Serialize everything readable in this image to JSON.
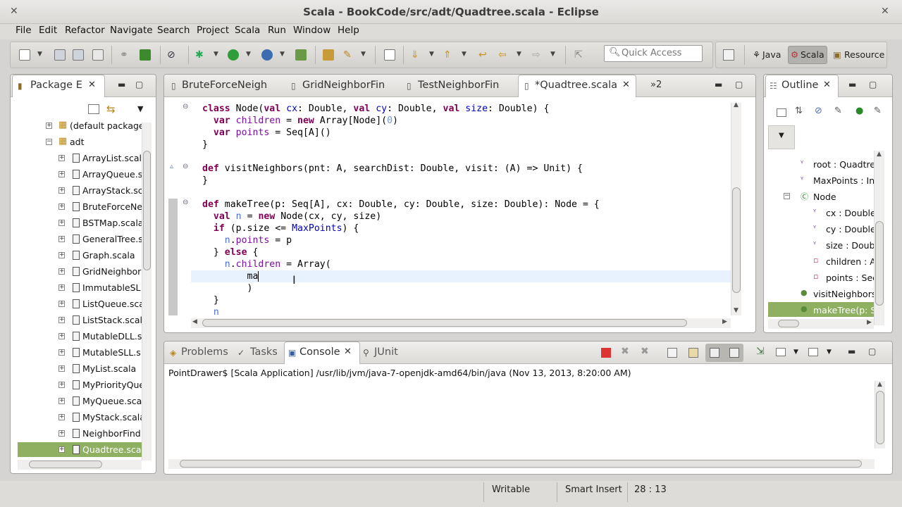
{
  "window": {
    "title": "Scala - BookCode/src/adt/Quadtree.scala - Eclipse"
  },
  "menu": [
    "File",
    "Edit",
    "Refactor",
    "Navigate",
    "Search",
    "Project",
    "Scala",
    "Run",
    "Window",
    "Help"
  ],
  "quick_access": {
    "placeholder": "Quick Access"
  },
  "perspectives": [
    "Java",
    "Scala",
    "Resource"
  ],
  "package_explorer": {
    "title": "Package E",
    "items": [
      {
        "label": "(default package",
        "level": 1
      },
      {
        "label": "adt",
        "level": 1
      },
      {
        "label": "ArrayList.scala",
        "level": 2
      },
      {
        "label": "ArrayQueue.s",
        "level": 2
      },
      {
        "label": "ArrayStack.sc",
        "level": 2
      },
      {
        "label": "BruteForceNe",
        "level": 2
      },
      {
        "label": "BSTMap.scala",
        "level": 2
      },
      {
        "label": "GeneralTree.s",
        "level": 2
      },
      {
        "label": "Graph.scala",
        "level": 2
      },
      {
        "label": "GridNeighbor",
        "level": 2
      },
      {
        "label": "ImmutableSL",
        "level": 2
      },
      {
        "label": "ListQueue.sca",
        "level": 2
      },
      {
        "label": "ListStack.scal",
        "level": 2
      },
      {
        "label": "MutableDLL.s",
        "level": 2
      },
      {
        "label": "MutableSLL.s",
        "level": 2
      },
      {
        "label": "MyList.scala",
        "level": 2
      },
      {
        "label": "MyPriorityQue",
        "level": 2
      },
      {
        "label": "MyQueue.sca",
        "level": 2
      },
      {
        "label": "MyStack.scala",
        "level": 2
      },
      {
        "label": "NeighborFind",
        "level": 2
      },
      {
        "label": "Quadtree.sca",
        "level": 2,
        "selected": true
      }
    ]
  },
  "editor": {
    "tabs": [
      "BruteForceNeigh",
      "GridNeighborFin",
      "TestNeighborFin",
      "*Quadtree.scala"
    ],
    "overflow": "»2",
    "active_tab": 3
  },
  "outline": {
    "title": "Outline",
    "items": [
      "root : Quadtree",
      "MaxPoints : Int",
      "Node",
      "cx : Double",
      "cy : Double",
      "size : Double",
      "children : A",
      "points : Sec",
      "visitNeighbors(",
      "makeTree(p: S"
    ]
  },
  "bottom": {
    "tabs": [
      "Problems",
      "Tasks",
      "Console",
      "JUnit"
    ],
    "active_tab": "Console",
    "console_header": "PointDrawer$ [Scala Application] /usr/lib/jvm/java-7-openjdk-amd64/bin/java (Nov 13, 2013, 8:20:00 AM)"
  },
  "status": {
    "writable": "Writable",
    "insert_mode": "Smart Insert",
    "position": "28 : 13"
  }
}
